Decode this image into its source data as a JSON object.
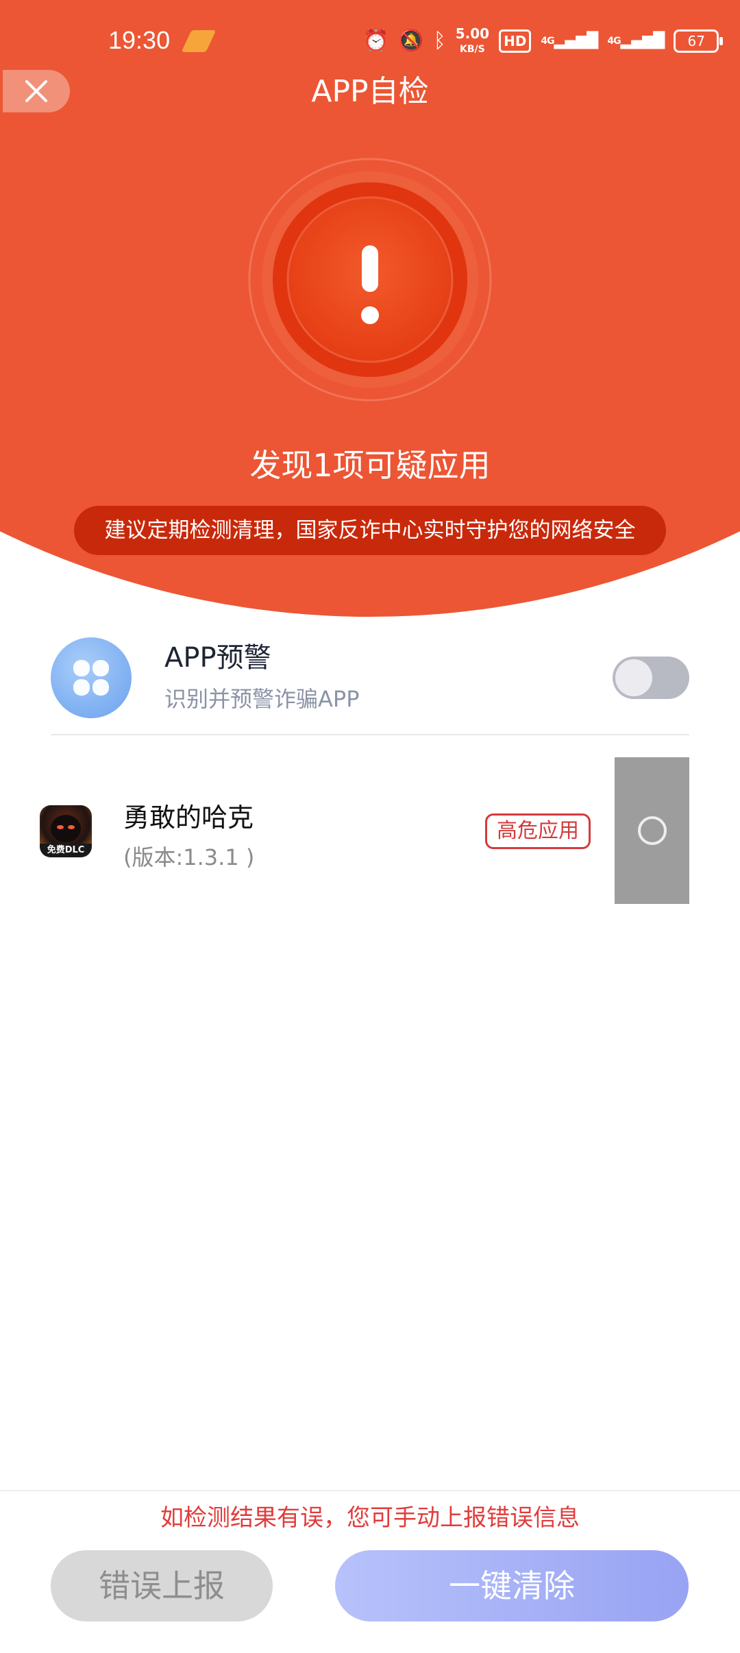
{
  "status_bar": {
    "time": "19:30",
    "net_speed_value": "5.00",
    "net_speed_unit": "KB/S",
    "hd_label": "HD",
    "signal1_label": "4G",
    "signal2_label": "4G",
    "battery": "67",
    "icons": [
      "alarm-icon",
      "mute-icon",
      "bluetooth-icon",
      "hd-icon",
      "signal-icon",
      "signal-icon",
      "battery-icon"
    ]
  },
  "header": {
    "title": "APP自检",
    "found_text": "发现1项可疑应用",
    "tip": "建议定期检测清理，国家反诈中心实时守护您的网络安全",
    "colors": {
      "background": "#ec5634",
      "pill": "#c9290b"
    }
  },
  "warning": {
    "title": "APP预警",
    "subtitle": "识别并预警诈骗APP",
    "toggle_on": false
  },
  "apps": [
    {
      "name": "勇敢的哈克",
      "version": "(版本:1.3.1 )",
      "badge": "高危应用",
      "icon_text": "免费DLC",
      "selected": false
    }
  ],
  "footer": {
    "hint": "如检测结果有误，您可手动上报错误信息",
    "report_label": "错误上报",
    "clear_label": "一键清除"
  }
}
